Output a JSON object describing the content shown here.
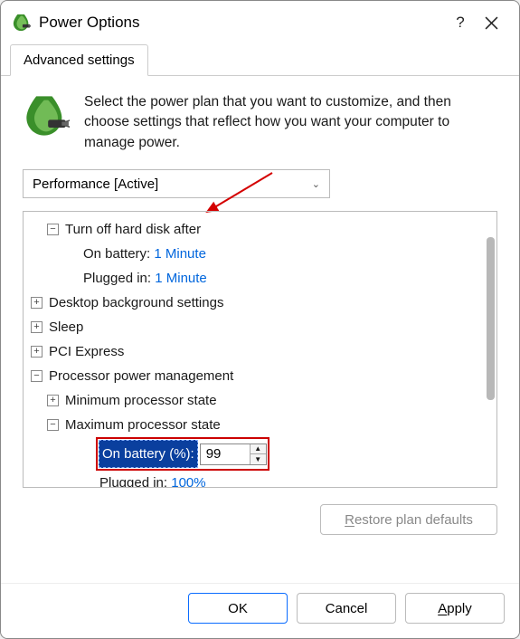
{
  "titlebar": {
    "title": "Power Options"
  },
  "tab": {
    "label": "Advanced settings"
  },
  "intro": {
    "text": "Select the power plan that you want to customize, and then choose settings that reflect how you want your computer to manage power."
  },
  "plan": {
    "selected": "Performance [Active]"
  },
  "tree": {
    "hard_disk": {
      "label": "Turn off hard disk after",
      "on_battery_label": "On battery:",
      "on_battery_value": "1 Minute",
      "plugged_in_label": "Plugged in:",
      "plugged_in_value": "1 Minute"
    },
    "desktop_bg": {
      "label": "Desktop background settings"
    },
    "sleep": {
      "label": "Sleep"
    },
    "pci": {
      "label": "PCI Express"
    },
    "proc": {
      "label": "Processor power management",
      "min_state": {
        "label": "Minimum processor state"
      },
      "max_state": {
        "label": "Maximum processor state",
        "on_battery_label": "On battery (%):",
        "on_battery_value": "99",
        "plugged_in_label": "Plugged in:",
        "plugged_in_value": "100%"
      }
    }
  },
  "buttons": {
    "restore": "estore plan defaults",
    "restore_prefix": "R",
    "ok": "OK",
    "cancel": "Cancel",
    "apply_prefix": "A",
    "apply_suffix": "pply"
  }
}
